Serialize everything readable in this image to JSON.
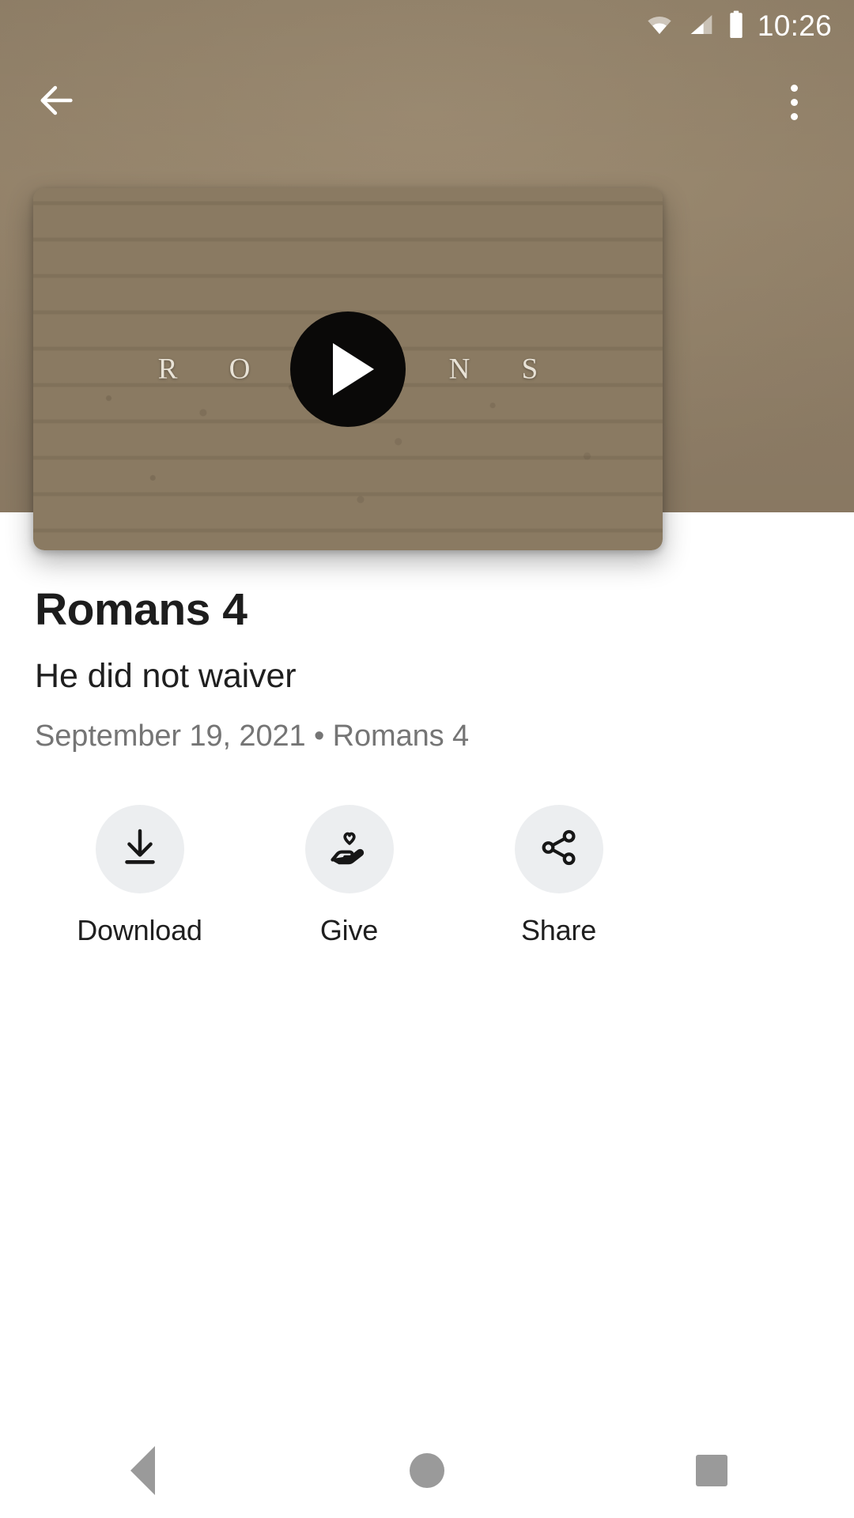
{
  "status_bar": {
    "time": "10:26",
    "icons": [
      "wifi-icon",
      "cellular-signal-icon",
      "battery-icon"
    ]
  },
  "app_bar": {
    "back_icon": "arrow-back-icon",
    "overflow_icon": "more-vertical-icon"
  },
  "video": {
    "series_wordmark": "R O M A N S",
    "play_icon": "play-icon"
  },
  "details": {
    "title": "Romans 4",
    "subtitle": "He did not waiver",
    "meta": "September 19, 2021 • Romans 4"
  },
  "actions": [
    {
      "label": "Download",
      "icon": "download-icon"
    },
    {
      "label": "Give",
      "icon": "hand-heart-icon"
    },
    {
      "label": "Share",
      "icon": "share-icon"
    }
  ],
  "nav_bar": {
    "back_label": "Back",
    "home_label": "Home",
    "recents_label": "Recents"
  },
  "colors": {
    "backdrop": "#95846b",
    "sheet": "#ffffff",
    "title_text": "#1d1d1d",
    "meta_text": "#757575",
    "action_circle": "#eceef0",
    "nav_icon": "#9a9a9a",
    "play_button": "#0a0908"
  }
}
